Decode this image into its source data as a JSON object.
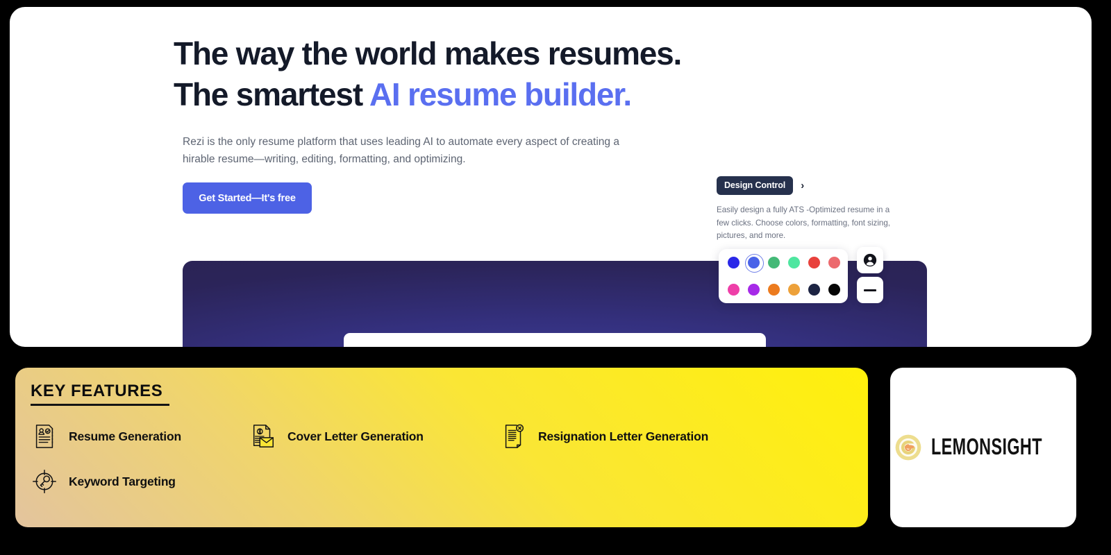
{
  "hero": {
    "headline_line1": "The way the world makes resumes.",
    "headline_line2_prefix": "The smartest ",
    "headline_line2_accent": "AI resume builder.",
    "subcopy": "Rezi is the only resume platform that uses leading AI to automate every aspect of creating a hirable resume—writing, editing, formatting, and optimizing.",
    "cta_label": "Get Started—It's free",
    "accent_color": "#5a6ff0",
    "cta_color": "#4d62e5"
  },
  "design_control": {
    "pill_label": "Design Control",
    "chevron": "›",
    "description": "Easily design a fully ATS -Optimized resume in a few clicks. Choose colors, formatting, font sizing, pictures, and more.",
    "pill_bg": "#26314d"
  },
  "palette": {
    "row1": [
      {
        "name": "blue",
        "hex": "#2a28e8",
        "selected": false
      },
      {
        "name": "royal-blue",
        "hex": "#4a63e8",
        "selected": true
      },
      {
        "name": "green",
        "hex": "#44b977",
        "selected": false
      },
      {
        "name": "mint-green",
        "hex": "#4fe6a0",
        "selected": false
      },
      {
        "name": "red",
        "hex": "#e8413c",
        "selected": false
      },
      {
        "name": "salmon",
        "hex": "#ec6a6e",
        "selected": false
      }
    ],
    "row2": [
      {
        "name": "pink",
        "hex": "#ee3fa8",
        "selected": false
      },
      {
        "name": "purple",
        "hex": "#a62ae8",
        "selected": false
      },
      {
        "name": "orange",
        "hex": "#ec7b1e",
        "selected": false
      },
      {
        "name": "amber",
        "hex": "#eda13a",
        "selected": false
      },
      {
        "name": "navy",
        "hex": "#1d2443",
        "selected": false
      },
      {
        "name": "black",
        "hex": "#050505",
        "selected": false
      }
    ]
  },
  "tools": [
    {
      "name": "user-avatar-icon",
      "label": "Profile picture"
    },
    {
      "name": "minus-icon",
      "label": "Remove"
    }
  ],
  "features": {
    "title": "KEY FEATURES",
    "items": [
      {
        "label": "Resume Generation",
        "icon": "resume-document-icon"
      },
      {
        "label": "Cover Letter Generation",
        "icon": "cover-letter-envelope-icon"
      },
      {
        "label": "Resignation Letter Generation",
        "icon": "resignation-document-x-icon"
      },
      {
        "label": "Keyword Targeting",
        "icon": "keyword-target-key-icon"
      }
    ],
    "gradient_start": "#fff00b",
    "gradient_end": "#e3c49e"
  },
  "brand": {
    "name": "LEMONSIGHT",
    "mark": "lemon-swirl-icon",
    "mark_color": "#ecd87a"
  }
}
